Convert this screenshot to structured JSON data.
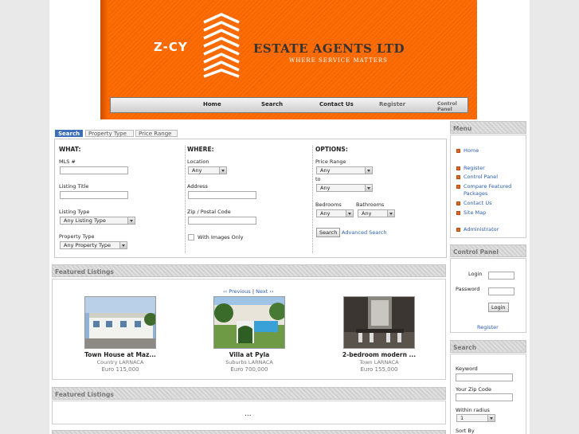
{
  "banner": {
    "logo_text": "Z-CY",
    "company": "ESTATE AGENTS LTD",
    "tagline": "WHERE SERVICE MATTERS",
    "nav": [
      "Home",
      "Search",
      "Contact Us",
      "Register",
      "Control Panel"
    ]
  },
  "search_tabs": [
    "Search",
    "Property Type",
    "Price Range"
  ],
  "form": {
    "what_title": "WHAT:",
    "where_title": "WHERE:",
    "options_title": "OPTIONS:",
    "mls_label": "MLS #",
    "listing_title_label": "Listing Title",
    "listing_type_label": "Listing Type",
    "listing_type_value": "Any Listing Type",
    "property_type_label": "Property Type",
    "property_type_value": "Any Property Type",
    "location_label": "Location",
    "location_value": "Any",
    "address_label": "Address",
    "zip_label": "Zip / Postal Code",
    "with_images_label": "With Images Only",
    "price_range_label": "Price Range",
    "price_from_value": "Any",
    "to_label": "to",
    "price_to_value": "Any",
    "bedrooms_label": "Bedrooms",
    "bedrooms_value": "Any",
    "bathrooms_label": "Bathrooms",
    "bathrooms_value": "Any",
    "search_button": "Search",
    "advanced_search": "Advanced Search"
  },
  "featured": {
    "title": "Featured Listings",
    "prev": "‹‹ Previous",
    "sep": "|",
    "next": "Next ››",
    "listings": [
      {
        "title": "Town House at Maz...",
        "area": "Country LARNACA",
        "price": "Euro 115,000"
      },
      {
        "title": "Villa at Pyla",
        "area": "Suburbs LARNACA",
        "price": "Euro 700,000"
      },
      {
        "title": "2-bedroom modern ...",
        "area": "Town LARNACA",
        "price": "Euro 155,000"
      }
    ]
  },
  "featured2": {
    "title": "Featured Listings",
    "ellipsis": "..."
  },
  "menu": {
    "title": "Menu",
    "items": [
      "Home",
      "Register",
      "Control Panel",
      "Compare Featured Packages",
      "Contact Us",
      "Site Map",
      "Administrator"
    ]
  },
  "control_panel": {
    "title": "Control Panel",
    "login_label": "Login",
    "password_label": "Password",
    "login_button": "Login",
    "register_link": "Register"
  },
  "side_search": {
    "title": "Search",
    "keyword_label": "Keyword",
    "zip_label": "Your Zip Code",
    "radius_label": "Within radius",
    "radius_value": "1",
    "sort_label": "Sort By"
  },
  "colors": {
    "banner_orange": "#ff6a00",
    "tab_active": "#3b6db8",
    "link": "#2a5db0",
    "bullet": "#e0671f"
  }
}
